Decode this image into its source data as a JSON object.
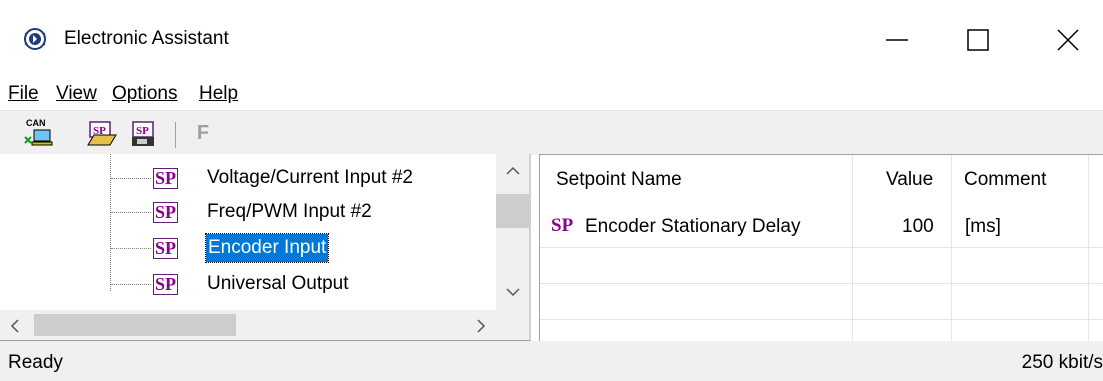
{
  "window": {
    "title": "Electronic Assistant",
    "icon": "electronic-assistant-icon"
  },
  "menu": [
    {
      "label": "File"
    },
    {
      "label": "View"
    },
    {
      "label": "Options"
    },
    {
      "label": "Help"
    }
  ],
  "toolbar": {
    "can_label": "CAN",
    "sp_label": "SP",
    "f_label": "F"
  },
  "tree": {
    "badge": "SP",
    "items": [
      {
        "label": "Voltage/Current Input #2"
      },
      {
        "label": "Freq/PWM Input #2"
      },
      {
        "label": "Encoder Input"
      },
      {
        "label": "Universal Output"
      }
    ]
  },
  "table": {
    "columns": [
      "Setpoint Name",
      "Value",
      "Comment"
    ],
    "rows": [
      {
        "badge": "SP",
        "name": "Encoder Stationary Delay",
        "value": "100",
        "comment": "[ms]"
      }
    ]
  },
  "status": {
    "text": "Ready",
    "rate": "250 kbit/s"
  },
  "colors": {
    "selection": "#0078d7",
    "sp_badge": "#8b008b"
  }
}
